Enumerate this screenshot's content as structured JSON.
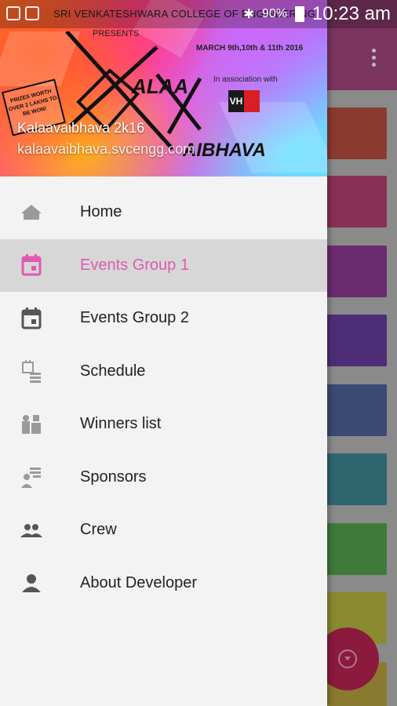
{
  "status_bar": {
    "battery": "90%",
    "time": "10:23 am"
  },
  "header": {
    "college": "SRI VENKATESHWARA COLLEGE OF ENGINEERING",
    "presents": "PRESENTS",
    "dates": "MARCH 9th,10th & 11th 2016",
    "association": "In association with",
    "partner_logo": "VH",
    "logo_word_1": "ALAA",
    "logo_word_2": "AIBHAVA",
    "prize": "PRIZES WORTH OVER 2 LAKHS TO BE WON!",
    "title": "Kalaavaibhava 2k16",
    "url": "kalaavaibhava.svcengg.com"
  },
  "menu": {
    "items": [
      {
        "label": "Home",
        "icon": "home-icon",
        "active": false
      },
      {
        "label": "Events Group 1",
        "icon": "calendar-icon",
        "active": true
      },
      {
        "label": "Events Group 2",
        "icon": "calendar-icon",
        "active": false
      },
      {
        "label": "Schedule",
        "icon": "schedule-icon",
        "active": false
      },
      {
        "label": "Winners list",
        "icon": "winners-icon",
        "active": false
      },
      {
        "label": "Sponsors",
        "icon": "sponsors-icon",
        "active": false
      },
      {
        "label": "Crew",
        "icon": "crew-icon",
        "active": false
      },
      {
        "label": "About Developer",
        "icon": "person-icon",
        "active": false
      }
    ]
  },
  "colors": {
    "accent": "#e05ab0",
    "drawer_bg": "#f3f3f3",
    "active_row_bg": "#d7d7d7",
    "fab": "#8b1a3e"
  }
}
